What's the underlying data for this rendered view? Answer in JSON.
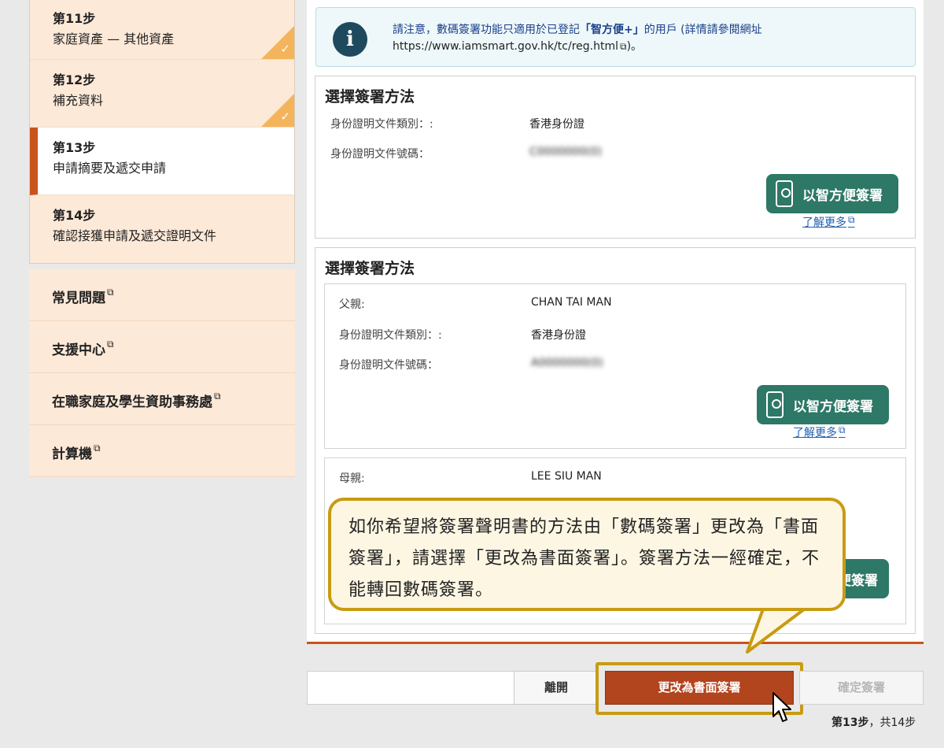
{
  "sidebar": {
    "steps": [
      {
        "num": "第11步",
        "desc": "家庭資產 — 其他資產",
        "done": true
      },
      {
        "num": "第12步",
        "desc": "補充資料",
        "done": true
      },
      {
        "num": "第13步",
        "desc": "申請摘要及遞交申請",
        "active": true
      },
      {
        "num": "第14步",
        "desc": "確認接獲申請及遞交證明文件"
      }
    ],
    "links": [
      {
        "label": "常見問題"
      },
      {
        "label": "支援中心"
      },
      {
        "label": "在職家庭及學生資助事務處"
      },
      {
        "label": "計算機"
      }
    ]
  },
  "notice": {
    "prefix": "請注意，數碼簽署功能只適用於已登記",
    "highlight": "「智方便+」",
    "suffix": "的用戶 (詳情請參閱網址",
    "url": "https://www.iamsmart.gov.hk/tc/reg.html",
    "tail": ")。"
  },
  "section1": {
    "title": "選擇簽署方法",
    "rows": [
      {
        "label": "身份證明文件類別：:",
        "value": "香港身份證"
      },
      {
        "label": "身份證明文件號碼：",
        "value": "C0000000(0)"
      }
    ],
    "button": "以智方便簽署",
    "learn_more": "了解更多"
  },
  "section2": {
    "title": "選擇簽署方法",
    "father": {
      "rows": [
        {
          "label": "父親:",
          "value": "CHAN TAI MAN"
        },
        {
          "label": "身份證明文件類別：:",
          "value": "香港身份證"
        },
        {
          "label": "身份證明文件號碼：",
          "value": "A0000000(0)"
        }
      ],
      "button": "以智方便簽署",
      "learn_more": "了解更多"
    },
    "mother": {
      "rows": [
        {
          "label": "母親:",
          "value": "LEE SIU MAN"
        }
      ],
      "button_partial": "便簽署"
    }
  },
  "callout": {
    "text": "如你希望將簽署聲明書的方法由「數碼簽署」更改為「書面簽署」，請選擇「更改為書面簽署」。簽署方法一經確定，不能轉回數碼簽署。"
  },
  "actions": {
    "leave": "離開",
    "change": "更改為書面簽署",
    "confirm": "確定簽署"
  },
  "progress": {
    "current": "第13步",
    "total": "，共14步"
  },
  "colors": {
    "accent": "#c9531d",
    "iam_green": "#2d7866",
    "callout_border": "#c89b12",
    "change_button": "#b2441e"
  }
}
